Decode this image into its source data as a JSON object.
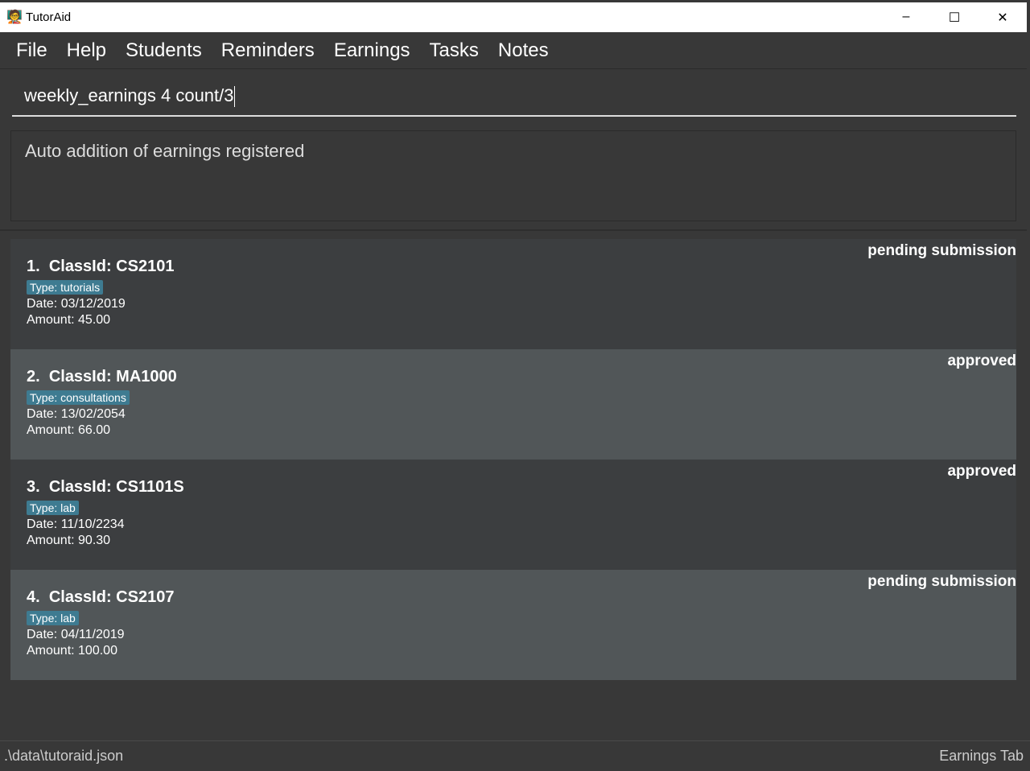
{
  "window": {
    "title": "TutorAid",
    "minimize": "–",
    "maximize": "☐",
    "close": "✕"
  },
  "menu": [
    "File",
    "Help",
    "Students",
    "Reminders",
    "Earnings",
    "Tasks",
    "Notes"
  ],
  "command": {
    "value": "weekly_earnings 4 count/3"
  },
  "result": {
    "message": "Auto addition of earnings registered"
  },
  "earnings": [
    {
      "index": "1.",
      "classid": "ClassId: CS2101",
      "type": "Type: tutorials",
      "date": "Date: 03/12/2019",
      "amount": "Amount: 45.00",
      "status": "pending submission"
    },
    {
      "index": "2.",
      "classid": "ClassId: MA1000",
      "type": "Type: consultations",
      "date": "Date: 13/02/2054",
      "amount": "Amount: 66.00",
      "status": "approved"
    },
    {
      "index": "3.",
      "classid": "ClassId: CS1101S",
      "type": "Type: lab",
      "date": "Date: 11/10/2234",
      "amount": "Amount: 90.30",
      "status": "approved"
    },
    {
      "index": "4.",
      "classid": "ClassId: CS2107",
      "type": "Type: lab",
      "date": "Date: 04/11/2019",
      "amount": "Amount: 100.00",
      "status": "pending submission"
    }
  ],
  "statusbar": {
    "path": ".\\data\\tutoraid.json",
    "tab": "Earnings Tab"
  },
  "colors": {
    "tag": "#3e7b91",
    "card_dark": "#3c3e40",
    "card_light": "#515658"
  }
}
